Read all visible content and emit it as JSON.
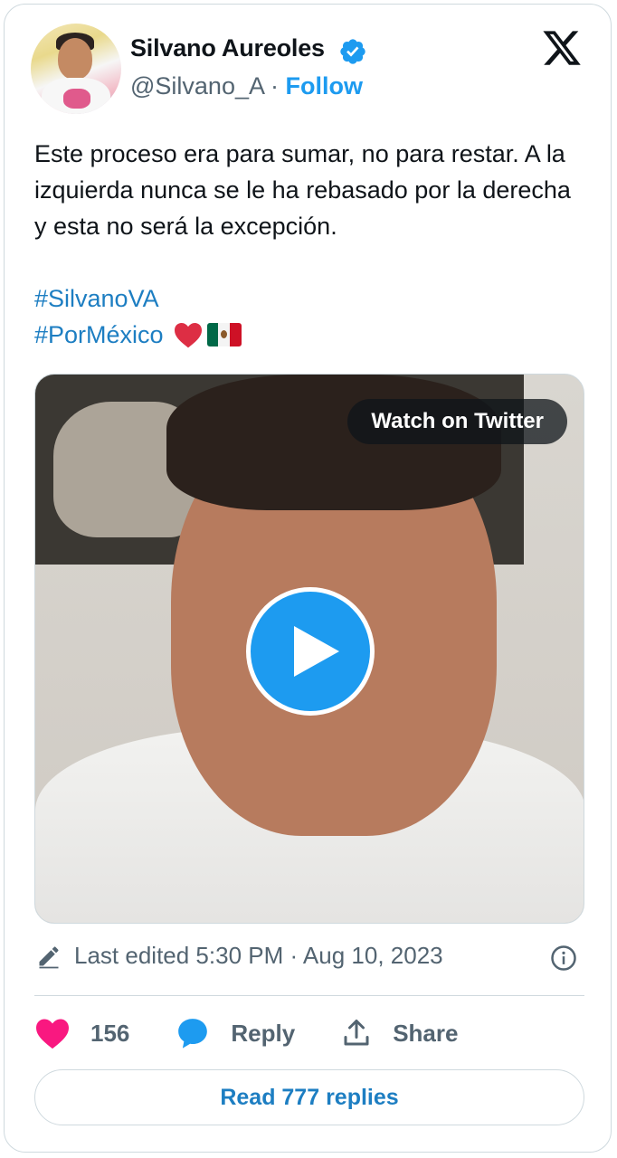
{
  "author": {
    "name": "Silvano Aureoles",
    "handle": "@Silvano_A",
    "separator": "·",
    "follow_label": "Follow"
  },
  "tweet": {
    "text": "Este proceso era para sumar, no para restar. A la izquierda nunca se le ha rebasado por la derecha y esta no será la excepción.",
    "hashtags": [
      "#SilvanoVA",
      "#PorMéxico"
    ]
  },
  "media": {
    "watch_label": "Watch on Twitter"
  },
  "meta": {
    "edited_text": "Last edited 5:30 PM · Aug 10, 2023"
  },
  "actions": {
    "likes_count": "156",
    "reply_label": "Reply",
    "share_label": "Share"
  },
  "read_replies_label": "Read 777 replies",
  "colors": {
    "accent": "#1d9bf0",
    "link": "#1d7ec2",
    "like": "#f91880",
    "muted": "#536471"
  },
  "icons": [
    "verified-badge-icon",
    "x-logo-icon",
    "heart-emoji-icon",
    "mexico-flag-icon",
    "play-icon",
    "pencil-icon",
    "info-icon",
    "heart-icon",
    "reply-bubble-icon",
    "share-icon"
  ]
}
